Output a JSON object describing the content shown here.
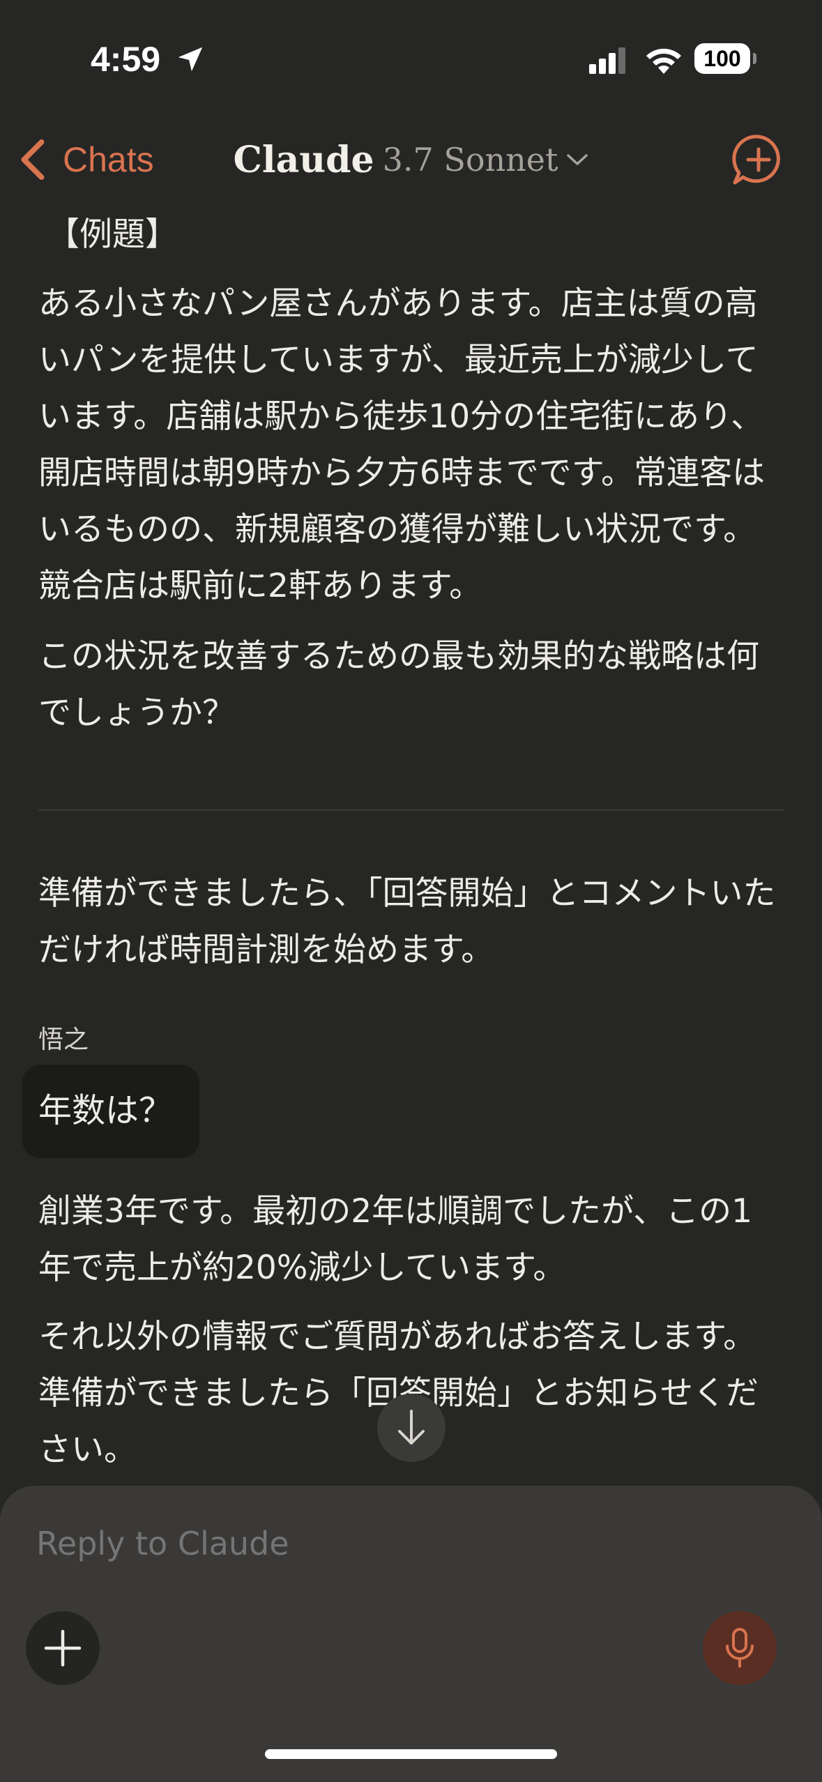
{
  "status_bar": {
    "time": "4:59",
    "battery": "100"
  },
  "nav": {
    "back_label": "Chats",
    "title_name": "Claude",
    "title_model": "3.7 Sonnet"
  },
  "messages": {
    "heading": "【例題】",
    "problem": "ある小さなパン屋さんがあります。店主は質の高いパンを提供していますが、最近売上が減少しています。店舗は駅から徒歩10分の住宅街にあり、開店時間は朝9時から夕方6時までです。常連客はいるものの、新規顧客の獲得が難しい状況です。競合店は駅前に2軒あります。",
    "question": "この状況を改善するための最も効果的な戦略は何でしょうか？",
    "prompt_start": "準備ができましたら、「回答開始」とコメントいただければ時間計測を始めます。",
    "user_name": "悟之",
    "user_message": "年数は？",
    "reply_1": "創業3年です。最初の2年は順調でしたが、この1年で売上が約20%減少しています。",
    "reply_2": "それ以外の情報でご質問があればお答えします。準備ができましたら「回答開始」とお知らせください。"
  },
  "composer": {
    "placeholder": "Reply to Claude"
  },
  "colors": {
    "accent": "#d9744f",
    "background": "#262625",
    "composer": "#3a3937",
    "mic_button": "#5a2e22"
  },
  "icons": [
    "location-arrow-icon",
    "signal-icon",
    "wifi-icon",
    "chevron-left-icon",
    "chevron-down-icon",
    "new-chat-icon",
    "arrow-down-icon",
    "plus-icon",
    "microphone-icon"
  ]
}
